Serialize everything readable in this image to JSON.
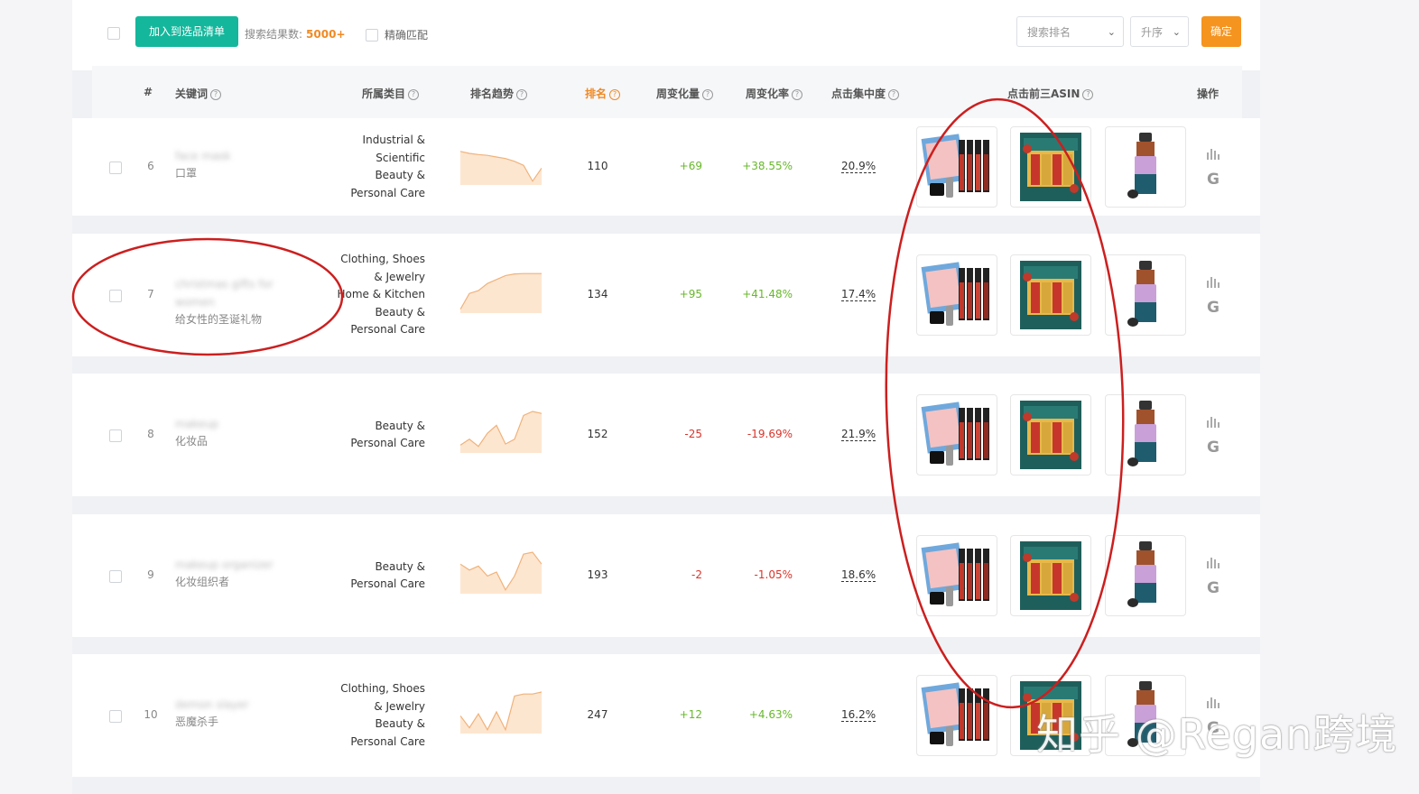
{
  "toolbar": {
    "add_label": "加入到选品清单",
    "result_label": "搜索结果数:",
    "result_count": "5000+",
    "exact_label": "精确匹配",
    "sort_field": "搜索排名",
    "sort_order": "升序",
    "confirm_label": "确定"
  },
  "table": {
    "headers": {
      "index": "#",
      "keyword": "关键词",
      "category": "所属类目",
      "trend": "排名趋势",
      "rank": "排名",
      "weekly_change": "周变化量",
      "weekly_rate": "周变化率",
      "click_conc": "点击集中度",
      "top3_asin": "点击前三ASIN",
      "actions": "操作"
    },
    "rows": [
      {
        "index": "6",
        "keyword": "face mask",
        "keyword_cn": "口罩",
        "category": [
          "Industrial &",
          "Scientific",
          "Beauty &",
          "Personal Care"
        ],
        "trend": [
          0.2,
          0.25,
          0.28,
          0.3,
          0.34,
          0.38,
          0.45,
          0.55,
          0.95,
          0.62
        ],
        "rank": "110",
        "change": "+69",
        "rate": "+38.55%",
        "conc": "20.9%",
        "dir": "pos"
      },
      {
        "index": "7",
        "keyword": "christmas gifts for women",
        "keyword_cn": "给女性的圣诞礼物",
        "category": [
          "Clothing, Shoes",
          "& Jewelry",
          "Home & Kitchen",
          "Beauty &",
          "Personal Care"
        ],
        "trend": [
          0.95,
          0.55,
          0.48,
          0.3,
          0.2,
          0.1,
          0.06,
          0.05,
          0.05,
          0.05
        ],
        "rank": "134",
        "change": "+95",
        "rate": "+41.48%",
        "conc": "17.4%",
        "dir": "pos"
      },
      {
        "index": "8",
        "keyword": "makeup",
        "keyword_cn": "化妆品",
        "category": [
          "Beauty &",
          "Personal Care"
        ],
        "trend": [
          0.85,
          0.7,
          0.88,
          0.55,
          0.35,
          0.82,
          0.7,
          0.1,
          0.0,
          0.05
        ],
        "rank": "152",
        "change": "-25",
        "rate": "-19.69%",
        "conc": "21.9%",
        "dir": "neg"
      },
      {
        "index": "9",
        "keyword": "makeup organizer",
        "keyword_cn": "化妆组织者",
        "category": [
          "Beauty &",
          "Personal Care"
        ],
        "trend": [
          0.3,
          0.45,
          0.35,
          0.6,
          0.5,
          0.95,
          0.6,
          0.05,
          0.0,
          0.3
        ],
        "rank": "193",
        "change": "-2",
        "rate": "-1.05%",
        "conc": "18.6%",
        "dir": "neg"
      },
      {
        "index": "10",
        "keyword": "demon slayer",
        "keyword_cn": "恶魔杀手",
        "category": [
          "Clothing, Shoes",
          "& Jewelry",
          "Beauty &",
          "Personal Care"
        ],
        "trend": [
          0.6,
          0.9,
          0.55,
          0.95,
          0.5,
          0.95,
          0.1,
          0.05,
          0.05,
          0.0
        ],
        "rank": "247",
        "change": "+12",
        "rate": "+4.63%",
        "conc": "16.2%",
        "dir": "pos"
      }
    ]
  },
  "watermark": "知乎 @Regan跨境",
  "colors": {
    "primary": "#14b79c",
    "accent": "#f5941f",
    "positive": "#67b82a",
    "negative": "#d9342b",
    "annotation": "#cc1f1f",
    "sparkline_fill": "#fde6d0",
    "sparkline_stroke": "#f0b27a"
  }
}
